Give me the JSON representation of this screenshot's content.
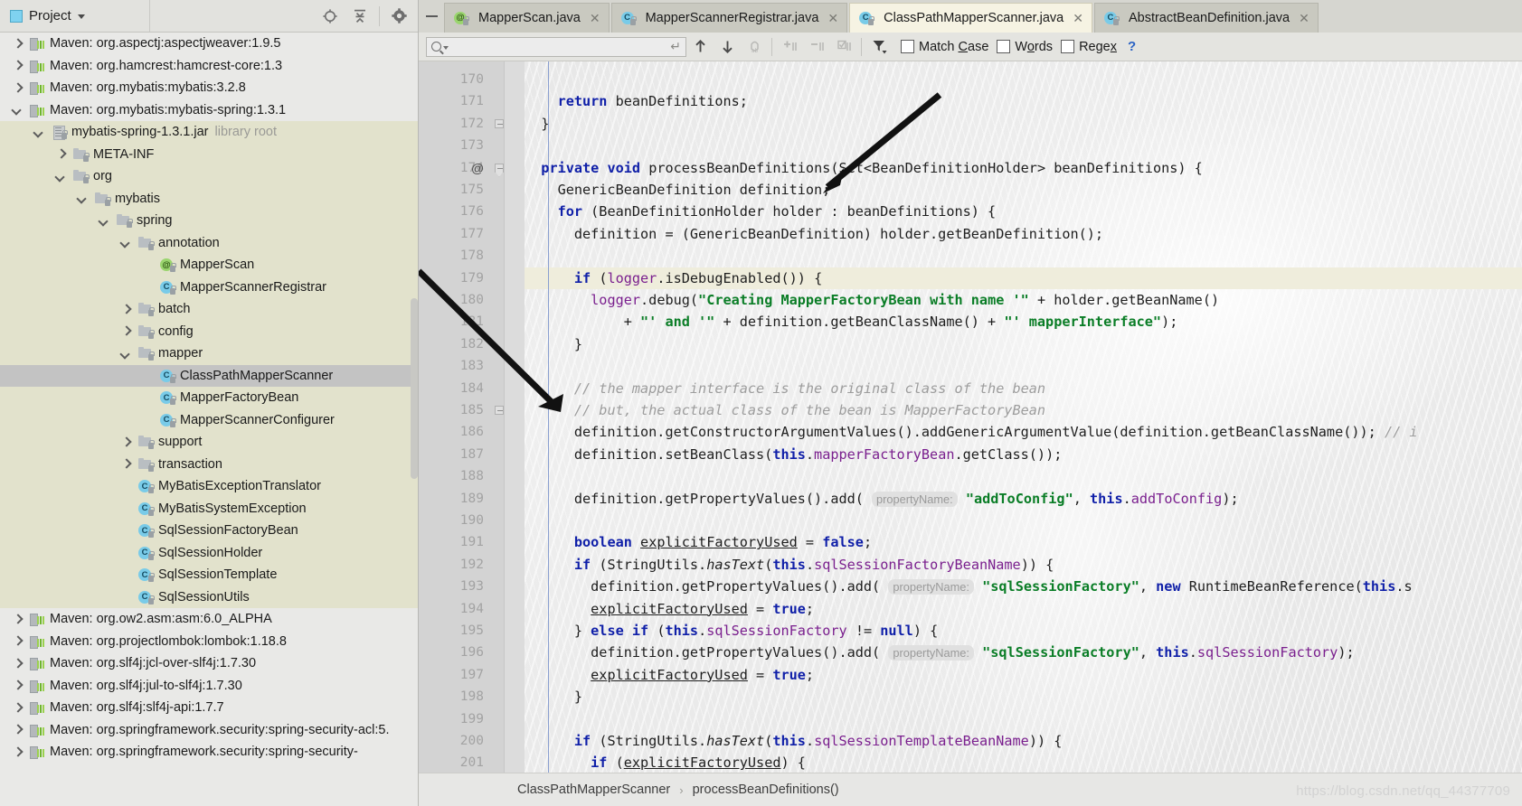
{
  "project_panel": {
    "title": "Project",
    "icons": [
      "locate-icon",
      "collapse-all-icon",
      "settings-gear-icon"
    ],
    "tree": [
      {
        "label": "Maven: org.aspectj:aspectjweaver:1.9.5",
        "icon": "maven-library-icon",
        "arrow": "closed",
        "depth": 0,
        "bg": "plain"
      },
      {
        "label": "Maven: org.hamcrest:hamcrest-core:1.3",
        "icon": "maven-library-icon",
        "arrow": "closed",
        "depth": 0,
        "bg": "plain"
      },
      {
        "label": "Maven: org.mybatis:mybatis:3.2.8",
        "icon": "maven-library-icon",
        "arrow": "closed",
        "depth": 0,
        "bg": "plain"
      },
      {
        "label": "Maven: org.mybatis:mybatis-spring:1.3.1",
        "icon": "maven-library-icon",
        "arrow": "open",
        "depth": 0,
        "bg": "plain"
      },
      {
        "label": "mybatis-spring-1.3.1.jar",
        "suffix": "library root",
        "icon": "jar-icon",
        "arrow": "open",
        "depth": 1,
        "bg": "jar"
      },
      {
        "label": "META-INF",
        "icon": "folder-locked-icon",
        "arrow": "closed",
        "depth": 2,
        "bg": "jar"
      },
      {
        "label": "org",
        "icon": "folder-locked-icon",
        "arrow": "open",
        "depth": 2,
        "bg": "jar"
      },
      {
        "label": "mybatis",
        "icon": "folder-locked-icon",
        "arrow": "open",
        "depth": 3,
        "bg": "jar"
      },
      {
        "label": "spring",
        "icon": "folder-locked-icon",
        "arrow": "open",
        "depth": 4,
        "bg": "jar"
      },
      {
        "label": "annotation",
        "icon": "folder-locked-icon",
        "arrow": "open",
        "depth": 5,
        "bg": "jar"
      },
      {
        "label": "MapperScan",
        "icon": "annotation-icon",
        "arrow": "none",
        "depth": 6,
        "bg": "jar"
      },
      {
        "label": "MapperScannerRegistrar",
        "icon": "class-icon",
        "arrow": "none",
        "depth": 6,
        "bg": "jar"
      },
      {
        "label": "batch",
        "icon": "folder-locked-icon",
        "arrow": "closed",
        "depth": 5,
        "bg": "jar"
      },
      {
        "label": "config",
        "icon": "folder-locked-icon",
        "arrow": "closed",
        "depth": 5,
        "bg": "jar"
      },
      {
        "label": "mapper",
        "icon": "folder-locked-icon",
        "arrow": "open",
        "depth": 5,
        "bg": "jar"
      },
      {
        "label": "ClassPathMapperScanner",
        "icon": "class-icon",
        "arrow": "none",
        "depth": 6,
        "bg": "selected"
      },
      {
        "label": "MapperFactoryBean",
        "icon": "class-icon",
        "arrow": "none",
        "depth": 6,
        "bg": "jar"
      },
      {
        "label": "MapperScannerConfigurer",
        "icon": "class-icon",
        "arrow": "none",
        "depth": 6,
        "bg": "jar"
      },
      {
        "label": "support",
        "icon": "folder-locked-icon",
        "arrow": "closed",
        "depth": 5,
        "bg": "jar"
      },
      {
        "label": "transaction",
        "icon": "folder-locked-icon",
        "arrow": "closed",
        "depth": 5,
        "bg": "jar"
      },
      {
        "label": "MyBatisExceptionTranslator",
        "icon": "class-icon",
        "arrow": "none",
        "depth": 5,
        "bg": "jar"
      },
      {
        "label": "MyBatisSystemException",
        "icon": "class-icon",
        "arrow": "none",
        "depth": 5,
        "bg": "jar"
      },
      {
        "label": "SqlSessionFactoryBean",
        "icon": "class-icon",
        "arrow": "none",
        "depth": 5,
        "bg": "jar"
      },
      {
        "label": "SqlSessionHolder",
        "icon": "class-icon",
        "arrow": "none",
        "depth": 5,
        "bg": "jar"
      },
      {
        "label": "SqlSessionTemplate",
        "icon": "class-icon",
        "arrow": "none",
        "depth": 5,
        "bg": "jar"
      },
      {
        "label": "SqlSessionUtils",
        "icon": "class-icon",
        "arrow": "none",
        "depth": 5,
        "bg": "jar"
      },
      {
        "label": "Maven: org.ow2.asm:asm:6.0_ALPHA",
        "icon": "maven-library-icon",
        "arrow": "closed",
        "depth": 0,
        "bg": "plain"
      },
      {
        "label": "Maven: org.projectlombok:lombok:1.18.8",
        "icon": "maven-library-icon",
        "arrow": "closed",
        "depth": 0,
        "bg": "plain"
      },
      {
        "label": "Maven: org.slf4j:jcl-over-slf4j:1.7.30",
        "icon": "maven-library-icon",
        "arrow": "closed",
        "depth": 0,
        "bg": "plain"
      },
      {
        "label": "Maven: org.slf4j:jul-to-slf4j:1.7.30",
        "icon": "maven-library-icon",
        "arrow": "closed",
        "depth": 0,
        "bg": "plain"
      },
      {
        "label": "Maven: org.slf4j:slf4j-api:1.7.7",
        "icon": "maven-library-icon",
        "arrow": "closed",
        "depth": 0,
        "bg": "plain"
      },
      {
        "label": "Maven: org.springframework.security:spring-security-acl:5.",
        "icon": "maven-library-icon",
        "arrow": "closed",
        "depth": 0,
        "bg": "plain"
      },
      {
        "label": "Maven: org.springframework.security:spring-security-",
        "icon": "maven-library-icon",
        "arrow": "closed",
        "depth": 0,
        "bg": "plain"
      }
    ]
  },
  "tabs": [
    {
      "label": "MapperScan.java",
      "icon": "annotation-icon",
      "active": false
    },
    {
      "label": "MapperScannerRegistrar.java",
      "icon": "class-icon",
      "active": false
    },
    {
      "label": "ClassPathMapperScanner.java",
      "icon": "class-icon",
      "active": true
    },
    {
      "label": "AbstractBeanDefinition.java",
      "icon": "class-icon",
      "active": false
    }
  ],
  "find_bar": {
    "search_value": "",
    "search_placeholder": "",
    "match_case": {
      "label_pre": "Match ",
      "label_key": "C",
      "label_post": "ase",
      "checked": false
    },
    "words": {
      "label_pre": "W",
      "label_key": "o",
      "label_post": "rds",
      "checked": false
    },
    "regex": {
      "label_pre": "Rege",
      "label_key": "x",
      "label_post": "",
      "checked": false
    },
    "help": "?",
    "icons": [
      "search-icon",
      "enter-icon",
      "find-previous-icon",
      "find-next-icon",
      "select-all-occurrences-icon",
      "add-selection-icon",
      "remove-selection-icon",
      "toggle-selection-icon",
      "filter-icon"
    ]
  },
  "editor": {
    "first_line": 170,
    "caret_line": 179,
    "annotation_marker_line": 174,
    "lines": [
      {
        "n": 170,
        "tokens": []
      },
      {
        "n": 171,
        "tokens": [
          {
            "t": "    ",
            "c": ""
          },
          {
            "t": "return",
            "c": "k"
          },
          {
            "t": " beanDefinitions;",
            "c": ""
          }
        ]
      },
      {
        "n": 172,
        "tokens": [
          {
            "t": "  }",
            "c": ""
          }
        ],
        "fold": "end"
      },
      {
        "n": 173,
        "tokens": []
      },
      {
        "n": 174,
        "at": true,
        "fold": "start",
        "tokens": [
          {
            "t": "  ",
            "c": ""
          },
          {
            "t": "private",
            "c": "k"
          },
          {
            "t": " ",
            "c": ""
          },
          {
            "t": "void",
            "c": "k"
          },
          {
            "t": " processBeanDefinitions(Set<BeanDefinitionHolder> beanDefinitions) {",
            "c": ""
          }
        ]
      },
      {
        "n": 175,
        "tokens": [
          {
            "t": "    GenericBeanDefinition definition;",
            "c": ""
          }
        ]
      },
      {
        "n": 176,
        "tokens": [
          {
            "t": "    ",
            "c": ""
          },
          {
            "t": "for",
            "c": "k"
          },
          {
            "t": " (BeanDefinitionHolder holder : beanDefinitions) {",
            "c": ""
          }
        ]
      },
      {
        "n": 177,
        "tokens": [
          {
            "t": "      definition = (GenericBeanDefinition) holder.getBeanDefinition();",
            "c": ""
          }
        ]
      },
      {
        "n": 178,
        "tokens": []
      },
      {
        "n": 179,
        "tokens": [
          {
            "t": "      ",
            "c": ""
          },
          {
            "t": "if",
            "c": "k"
          },
          {
            "t": " (",
            "c": ""
          },
          {
            "t": "logger",
            "c": "fld"
          },
          {
            "t": ".isDebugEnabled()) {",
            "c": ""
          }
        ]
      },
      {
        "n": 180,
        "tokens": [
          {
            "t": "        ",
            "c": ""
          },
          {
            "t": "logger",
            "c": "fld"
          },
          {
            "t": ".debug(",
            "c": ""
          },
          {
            "t": "\"Creating MapperFactoryBean with name '\"",
            "c": "str"
          },
          {
            "t": " + holder.getBeanName()",
            "c": ""
          }
        ]
      },
      {
        "n": 181,
        "tokens": [
          {
            "t": "            + ",
            "c": ""
          },
          {
            "t": "\"' and '\"",
            "c": "str"
          },
          {
            "t": " + definition.getBeanClassName() + ",
            "c": ""
          },
          {
            "t": "\"' mapperInterface\"",
            "c": "str"
          },
          {
            "t": ");",
            "c": ""
          }
        ]
      },
      {
        "n": 182,
        "tokens": [
          {
            "t": "      }",
            "c": ""
          }
        ]
      },
      {
        "n": 183,
        "tokens": []
      },
      {
        "n": 184,
        "tokens": [
          {
            "t": "      ",
            "c": ""
          },
          {
            "t": "// the mapper interface is the original class of the bean",
            "c": "cmt"
          }
        ]
      },
      {
        "n": 185,
        "fold": "end",
        "tokens": [
          {
            "t": "      ",
            "c": ""
          },
          {
            "t": "// but, the actual class of the bean is MapperFactoryBean",
            "c": "cmt"
          }
        ]
      },
      {
        "n": 186,
        "tokens": [
          {
            "t": "      definition.getConstructorArgumentValues().addGenericArgumentValue(definition.getBeanClassName()); ",
            "c": ""
          },
          {
            "t": "// i",
            "c": "cmt"
          }
        ]
      },
      {
        "n": 187,
        "tokens": [
          {
            "t": "      definition.setBeanClass(",
            "c": ""
          },
          {
            "t": "this",
            "c": "k"
          },
          {
            "t": ".",
            "c": ""
          },
          {
            "t": "mapperFactoryBean",
            "c": "fld"
          },
          {
            "t": ".getClass());",
            "c": ""
          }
        ]
      },
      {
        "n": 188,
        "tokens": []
      },
      {
        "n": 189,
        "tokens": [
          {
            "t": "      definition.getPropertyValues().add( ",
            "c": ""
          },
          {
            "t": "propertyName:",
            "c": "hint"
          },
          {
            "t": " ",
            "c": ""
          },
          {
            "t": "\"addToConfig\"",
            "c": "str"
          },
          {
            "t": ", ",
            "c": ""
          },
          {
            "t": "this",
            "c": "k"
          },
          {
            "t": ".",
            "c": ""
          },
          {
            "t": "addToConfig",
            "c": "fld"
          },
          {
            "t": ");",
            "c": ""
          }
        ]
      },
      {
        "n": 190,
        "tokens": []
      },
      {
        "n": 191,
        "tokens": [
          {
            "t": "      ",
            "c": ""
          },
          {
            "t": "boolean",
            "c": "k"
          },
          {
            "t": " ",
            "c": ""
          },
          {
            "t": "explicitFactoryUsed",
            "c": "und"
          },
          {
            "t": " = ",
            "c": ""
          },
          {
            "t": "false",
            "c": "k"
          },
          {
            "t": ";",
            "c": ""
          }
        ]
      },
      {
        "n": 192,
        "tokens": [
          {
            "t": "      ",
            "c": ""
          },
          {
            "t": "if",
            "c": "k"
          },
          {
            "t": " (StringUtils.",
            "c": ""
          },
          {
            "t": "hasText",
            "c": "ital"
          },
          {
            "t": "(",
            "c": ""
          },
          {
            "t": "this",
            "c": "k"
          },
          {
            "t": ".",
            "c": ""
          },
          {
            "t": "sqlSessionFactoryBeanName",
            "c": "fld"
          },
          {
            "t": ")) {",
            "c": ""
          }
        ]
      },
      {
        "n": 193,
        "tokens": [
          {
            "t": "        definition.getPropertyValues().add( ",
            "c": ""
          },
          {
            "t": "propertyName:",
            "c": "hint"
          },
          {
            "t": " ",
            "c": ""
          },
          {
            "t": "\"sqlSessionFactory\"",
            "c": "str"
          },
          {
            "t": ", ",
            "c": ""
          },
          {
            "t": "new",
            "c": "k"
          },
          {
            "t": " RuntimeBeanReference(",
            "c": ""
          },
          {
            "t": "this",
            "c": "k"
          },
          {
            "t": ".s",
            "c": ""
          }
        ]
      },
      {
        "n": 194,
        "tokens": [
          {
            "t": "        ",
            "c": ""
          },
          {
            "t": "explicitFactoryUsed",
            "c": "und"
          },
          {
            "t": " = ",
            "c": ""
          },
          {
            "t": "true",
            "c": "k"
          },
          {
            "t": ";",
            "c": ""
          }
        ]
      },
      {
        "n": 195,
        "tokens": [
          {
            "t": "      } ",
            "c": ""
          },
          {
            "t": "else",
            "c": "k"
          },
          {
            "t": " ",
            "c": ""
          },
          {
            "t": "if",
            "c": "k"
          },
          {
            "t": " (",
            "c": ""
          },
          {
            "t": "this",
            "c": "k"
          },
          {
            "t": ".",
            "c": ""
          },
          {
            "t": "sqlSessionFactory",
            "c": "fld"
          },
          {
            "t": " != ",
            "c": ""
          },
          {
            "t": "null",
            "c": "k"
          },
          {
            "t": ") {",
            "c": ""
          }
        ]
      },
      {
        "n": 196,
        "tokens": [
          {
            "t": "        definition.getPropertyValues().add( ",
            "c": ""
          },
          {
            "t": "propertyName:",
            "c": "hint"
          },
          {
            "t": " ",
            "c": ""
          },
          {
            "t": "\"sqlSessionFactory\"",
            "c": "str"
          },
          {
            "t": ", ",
            "c": ""
          },
          {
            "t": "this",
            "c": "k"
          },
          {
            "t": ".",
            "c": ""
          },
          {
            "t": "sqlSessionFactory",
            "c": "fld"
          },
          {
            "t": ");",
            "c": ""
          }
        ]
      },
      {
        "n": 197,
        "tokens": [
          {
            "t": "        ",
            "c": ""
          },
          {
            "t": "explicitFactoryUsed",
            "c": "und"
          },
          {
            "t": " = ",
            "c": ""
          },
          {
            "t": "true",
            "c": "k"
          },
          {
            "t": ";",
            "c": ""
          }
        ]
      },
      {
        "n": 198,
        "tokens": [
          {
            "t": "      }",
            "c": ""
          }
        ]
      },
      {
        "n": 199,
        "tokens": []
      },
      {
        "n": 200,
        "tokens": [
          {
            "t": "      ",
            "c": ""
          },
          {
            "t": "if",
            "c": "k"
          },
          {
            "t": " (StringUtils.",
            "c": ""
          },
          {
            "t": "hasText",
            "c": "ital"
          },
          {
            "t": "(",
            "c": ""
          },
          {
            "t": "this",
            "c": "k"
          },
          {
            "t": ".",
            "c": ""
          },
          {
            "t": "sqlSessionTemplateBeanName",
            "c": "fld"
          },
          {
            "t": ")) {",
            "c": ""
          }
        ]
      },
      {
        "n": 201,
        "tokens": [
          {
            "t": "        ",
            "c": ""
          },
          {
            "t": "if",
            "c": "k"
          },
          {
            "t": " (",
            "c": ""
          },
          {
            "t": "explicitFactoryUsed",
            "c": "und"
          },
          {
            "t": ") {",
            "c": ""
          }
        ]
      }
    ]
  },
  "breadcrumb": {
    "class": "ClassPathMapperScanner",
    "separator": "›",
    "method": "processBeanDefinitions()"
  },
  "watermark": "https://blog.csdn.net/qq_44377709",
  "colors": {
    "keyword": "#0f1fa8",
    "string": "#0a7d26",
    "field": "#7a1f8e",
    "comment": "#9d9d9d",
    "selection": "#c3c3c3",
    "jar_bg": "#e2e2cc",
    "caret_line": "#efeddc",
    "active_tab": "#f6f3e3"
  }
}
